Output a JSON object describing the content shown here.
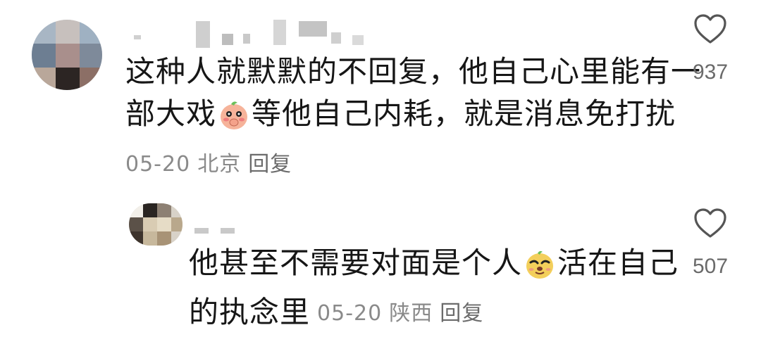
{
  "comments": [
    {
      "text_line1": "这种人就默默的不回复，他自己心里能有一",
      "text_line2_pre": "部大戏",
      "emoji": "shy-peach-emoji",
      "text_line2_post": "等他自己内耗，就是消息免打扰",
      "date": "05-20",
      "location": "北京",
      "reply_label": "回复",
      "likes": "937"
    },
    {
      "text_line1_pre": "他甚至不需要对面是个人",
      "emoji": "smirk-dog-emoji",
      "text_line1_post": "活在自己",
      "text_line2": "的执念里",
      "date": "05-20",
      "location": "陕西",
      "reply_label": "回复",
      "likes": "507"
    }
  ],
  "colors": {
    "text": "#161616",
    "meta": "#8a8a8a",
    "icon": "#555555"
  }
}
